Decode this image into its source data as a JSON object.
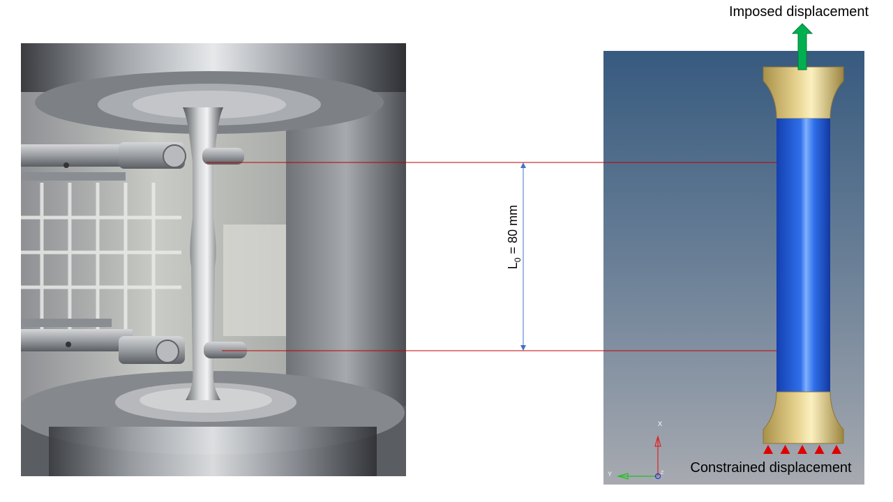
{
  "labels": {
    "imposed": "Imposed displacement",
    "constrained": "Constrained displacement",
    "gauge_symbol": "L",
    "gauge_subscript": "0",
    "gauge_value": " = 80 mm"
  },
  "triad": {
    "x": "X",
    "y": "Y",
    "z": "Z"
  },
  "colors": {
    "reference_lines": "#c00000",
    "dimension_arrow": "#4472c4",
    "load_arrow": "#00b050",
    "specimen_gauge": "#1f5fd6",
    "specimen_grips": "#d9c27a",
    "constraint_markers": "#e00000"
  },
  "constraint_marker_count": 5
}
